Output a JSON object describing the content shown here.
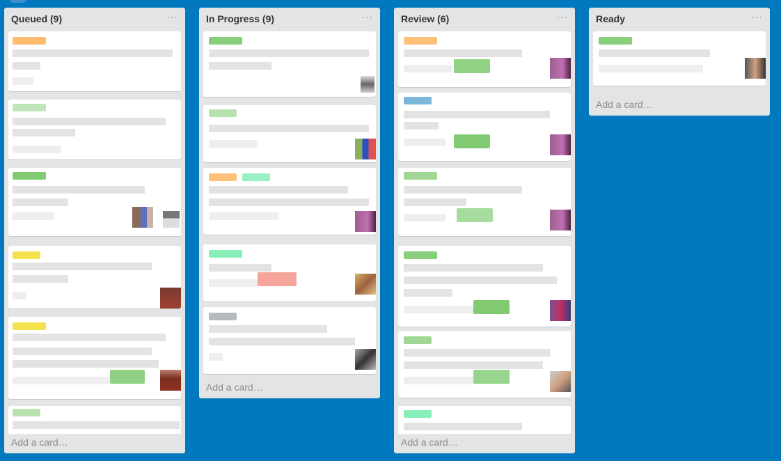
{
  "lists": [
    {
      "title": "Queued (9)",
      "menu": "···",
      "add_card": "Add a card…"
    },
    {
      "title": "In Progress (9)",
      "menu": "···",
      "add_card": "Add a card…"
    },
    {
      "title": "Review (6)",
      "menu": "···",
      "add_card": "Add a card…"
    },
    {
      "title": "Ready",
      "menu": "···",
      "add_card": "Add a card…"
    }
  ],
  "colors": {
    "board": "#0079bf",
    "list": "#e2e4e6",
    "label_orange": "#ffab4a",
    "label_green": "#61bd4f",
    "label_yellow": "#f2d600",
    "label_blue": "#0079bf",
    "label_teal": "#51e898",
    "label_red": "#eb5a46",
    "label_gray": "#838c91"
  }
}
